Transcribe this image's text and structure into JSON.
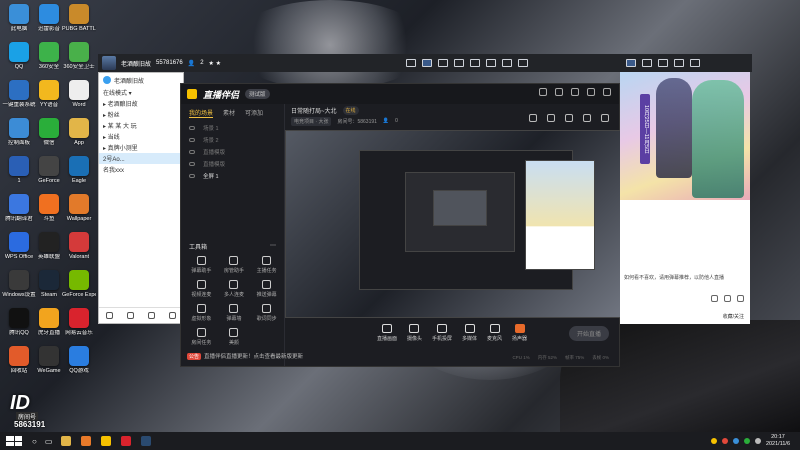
{
  "desktop": {
    "icons_col1": [
      {
        "label": "此电脑",
        "icon": "computer-icon",
        "color": "#3a8fd8"
      },
      {
        "label": "QQ",
        "icon": "qq-icon",
        "color": "#1aa1e6"
      },
      {
        "label": "一键重装系统",
        "icon": "reinstall-icon",
        "color": "#2c6fc2"
      },
      {
        "label": "控制面板",
        "icon": "control-panel-icon",
        "color": "#3c8cd6"
      },
      {
        "label": "1",
        "icon": "file-icon",
        "color": "#2a5fb5"
      },
      {
        "label": "腾讯翻译君",
        "icon": "translate-icon",
        "color": "#3b77e0"
      },
      {
        "label": "WPS Office",
        "icon": "wps-icon",
        "color": "#2b6be0"
      },
      {
        "label": "Windows设置",
        "icon": "settings-icon",
        "color": "#3a3a3a"
      },
      {
        "label": "腾讯QQ",
        "icon": "qq-penguin-icon",
        "color": "#111111"
      },
      {
        "label": "回收站",
        "icon": "recycle-bin-icon",
        "color": "#e25b2a"
      }
    ],
    "icons_col2": [
      {
        "label": "迅雷影音",
        "icon": "player-icon",
        "color": "#2d8ce0"
      },
      {
        "label": "360安全",
        "icon": "shield-icon",
        "color": "#3db24a"
      },
      {
        "label": "YY语音",
        "icon": "yy-icon",
        "color": "#f2b81e"
      },
      {
        "label": "微信",
        "icon": "wechat-icon",
        "color": "#2aae3a"
      },
      {
        "label": "GeForce",
        "icon": "geforce-icon",
        "color": "#444444"
      },
      {
        "label": "斗鱼",
        "icon": "douyu-icon",
        "color": "#f07020"
      },
      {
        "label": "英雄联盟",
        "icon": "lol-icon",
        "color": "#222222"
      },
      {
        "label": "Steam",
        "icon": "steam-icon",
        "color": "#1b2838"
      },
      {
        "label": "虎牙直播",
        "icon": "huya-icon",
        "color": "#f2a41e"
      },
      {
        "label": "WeGame",
        "icon": "wegame-icon",
        "color": "#333333"
      }
    ],
    "icons_col3": [
      {
        "label": "PUBG BATTLEGR...",
        "icon": "pubg-icon",
        "color": "#c98a2a"
      },
      {
        "label": "360安全卫士",
        "icon": "360-icon",
        "color": "#49b04a"
      },
      {
        "label": "Word",
        "icon": "doc-icon",
        "color": "#eeeeee"
      },
      {
        "label": "App",
        "icon": "folder-icon",
        "color": "#e2b548"
      },
      {
        "label": "Eagle",
        "icon": "eagle-icon",
        "color": "#1a6fb5"
      },
      {
        "label": "Wallpaper",
        "icon": "wallpaper-icon",
        "color": "#e27a2a"
      },
      {
        "label": "Valorant",
        "icon": "valorant-icon",
        "color": "#d43a3a"
      },
      {
        "label": "GeForce Experience",
        "icon": "nvidia-icon",
        "color": "#76b900"
      },
      {
        "label": "网易云音乐",
        "icon": "netease-music-icon",
        "color": "#d9232d"
      },
      {
        "label": "QQ游戏",
        "icon": "qq-game-icon",
        "color": "#2a7de0"
      }
    ]
  },
  "stream_bar": {
    "name": "老酒酿旧故  ",
    "id": "55781676",
    "fans": "2",
    "stars": "★ ★"
  },
  "qq_panel": {
    "header": "老酒酿旧故",
    "rows": [
      "在线模式 ▾",
      "▸ 老酒酿旧故 ",
      "▸ 粉丝",
      "▸ 某 某 大 玩",
      "▸ 当线",
      "▸ 真牌小测里",
      "2号Ao...",
      "名我xxx"
    ]
  },
  "app": {
    "brand": "直播伴侣",
    "version": "测试版",
    "tabs": [
      "我的场景",
      "素材",
      "可添加"
    ],
    "scenes": [
      "场景 1",
      "场景 2",
      "直播模版",
      "直播模版",
      "全屏 1"
    ],
    "room_title": "日常随打局~大北",
    "room_tag": "在线",
    "category": "电竞项目 · 大张",
    "room_id": "房间号：5863191",
    "viewers": "0",
    "tools_title": "工具箱",
    "tools": [
      "弹幕助手",
      "房管助手",
      "主播任务",
      "视频连麦",
      "多人连麦",
      "推送弹幕",
      "虚拟形象",
      "弹幕墙",
      "歌词同步",
      "房间任务",
      "美颜"
    ],
    "notice_badge": "公告",
    "notice": "直播伴侣直播更新！点击查看最新版更新",
    "bottom_items": [
      "直播画面",
      "摄像头",
      "手机投屏",
      "多媒体",
      "麦克风",
      "扬声器"
    ],
    "start_label": "开始直播",
    "status": [
      "CPU 1%",
      "内存 52%",
      "帧率 75%",
      "丢帧 0%"
    ]
  },
  "browser": {
    "date_text": "10月25日—11月5日",
    "body_text": "如何看不喜欢，请用弹幕推荐，以防他人直播",
    "footer": "收藏/关注"
  },
  "room_badge": {
    "big": "ID",
    "label": "房间号",
    "number": "5863191"
  },
  "taskbar": {
    "apps": [
      {
        "name": "folder",
        "color": "#e2b548"
      },
      {
        "name": "browser",
        "color": "#e87a2a"
      },
      {
        "name": "live-companion",
        "color": "#f7c200"
      },
      {
        "name": "netease",
        "color": "#d9232d"
      },
      {
        "name": "steam",
        "color": "#2a4a70"
      }
    ],
    "time": "20:17",
    "date": "2021/11/6"
  }
}
